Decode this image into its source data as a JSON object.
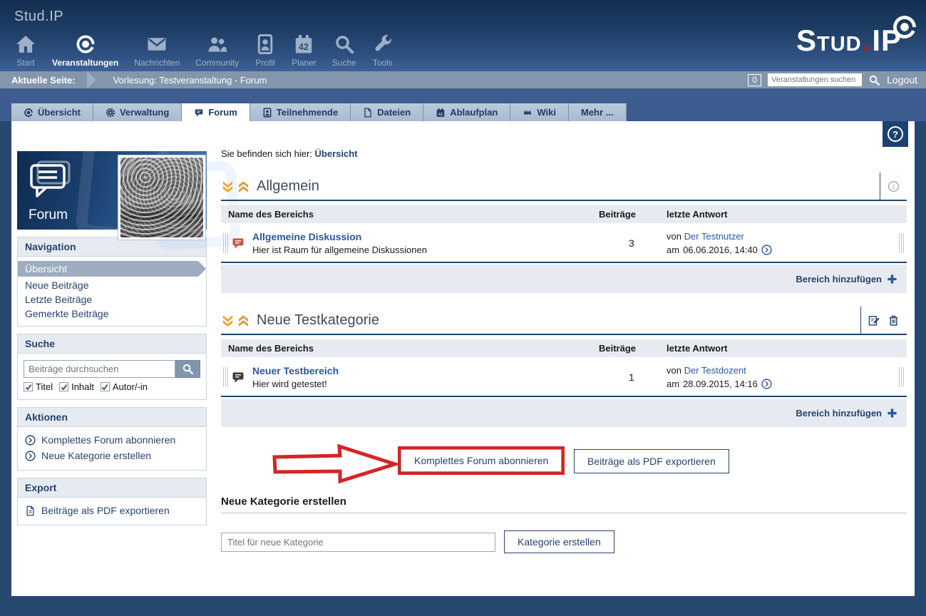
{
  "header": {
    "app_name": "Stud.IP",
    "logo": {
      "part1": "Stud",
      "dot": ".",
      "part2": "IP"
    },
    "nav_items": [
      {
        "label": "Start"
      },
      {
        "label": "Veranstaltungen"
      },
      {
        "label": "Nachrichten"
      },
      {
        "label": "Community"
      },
      {
        "label": "Profil"
      },
      {
        "label": "Planer"
      },
      {
        "label": "Suche"
      },
      {
        "label": "Tools"
      }
    ]
  },
  "breadcrumb": {
    "label": "Aktuelle Seite:",
    "current": "Vorlesung: Testveranstaltung - Forum",
    "counter": "0",
    "search_placeholder": "Veranstaltungen suchen",
    "logout": "Logout"
  },
  "tabs": [
    {
      "label": "Übersicht"
    },
    {
      "label": "Verwaltung"
    },
    {
      "label": "Forum"
    },
    {
      "label": "Teilnehmende"
    },
    {
      "label": "Dateien"
    },
    {
      "label": "Ablaufplan"
    },
    {
      "label": "Wiki"
    },
    {
      "label": "Mehr ..."
    }
  ],
  "sidebar": {
    "banner_title": "Forum",
    "navigation": {
      "title": "Navigation",
      "items": [
        {
          "label": "Übersicht",
          "active": true
        },
        {
          "label": "Neue Beiträge",
          "active": false
        },
        {
          "label": "Letzte Beiträge",
          "active": false
        },
        {
          "label": "Gemerkte Beiträge",
          "active": false
        }
      ]
    },
    "search": {
      "title": "Suche",
      "placeholder": "Beiträge durchsuchen",
      "checkboxes": [
        {
          "label": "Titel",
          "checked": true
        },
        {
          "label": "Inhalt",
          "checked": true
        },
        {
          "label": "Autor/-in",
          "checked": true
        }
      ]
    },
    "actions": {
      "title": "Aktionen",
      "items": [
        {
          "label": "Komplettes Forum abonnieren"
        },
        {
          "label": "Neue Kategorie erstellen"
        }
      ]
    },
    "export": {
      "title": "Export",
      "items": [
        {
          "label": "Beiträge als PDF exportieren"
        }
      ]
    }
  },
  "main": {
    "you_are_here_label": "Sie befinden sich hier:",
    "you_are_here_link": "Übersicht",
    "columns": {
      "name": "Name des Bereichs",
      "posts": "Beiträge",
      "last_answer": "letzte Antwort"
    },
    "categories": [
      {
        "title": "Allgemein",
        "rows": [
          {
            "name": "Allgemeine Diskussion",
            "description": "Hier ist Raum für allgemeine Diskussionen",
            "posts": "3",
            "by_label": "von",
            "author": "Der Testnutzer",
            "date_label": "am",
            "date": "06.06.2016, 14:40"
          }
        ],
        "footer_link": "Bereich hinzufügen"
      },
      {
        "title": "Neue Testkategorie",
        "rows": [
          {
            "name": "Neuer Testbereich",
            "description": "Hier wird getestet!",
            "posts": "1",
            "by_label": "von",
            "author": "Der Testdozent",
            "date_label": "am",
            "date": "28.09.2015, 14:16"
          }
        ],
        "footer_link": "Bereich hinzufügen"
      }
    ],
    "buttons": {
      "subscribe": "Komplettes Forum abonnieren",
      "export_pdf": "Beiträge als PDF exportieren"
    },
    "new_category": {
      "title": "Neue Kategorie erstellen",
      "input_placeholder": "Titel für neue Kategorie",
      "button": "Kategorie erstellen"
    }
  },
  "icons": {
    "calendar_text": "42",
    "help": "?",
    "info": "i"
  },
  "colors": {
    "accent_navy": "#24466e",
    "link_blue": "#2a57a0",
    "chevron_orange": "#eda938",
    "annotation_red": "#d42525",
    "unread_bubble_red": "#cf5348",
    "read_bubble_gray": "#3c3c3c"
  }
}
